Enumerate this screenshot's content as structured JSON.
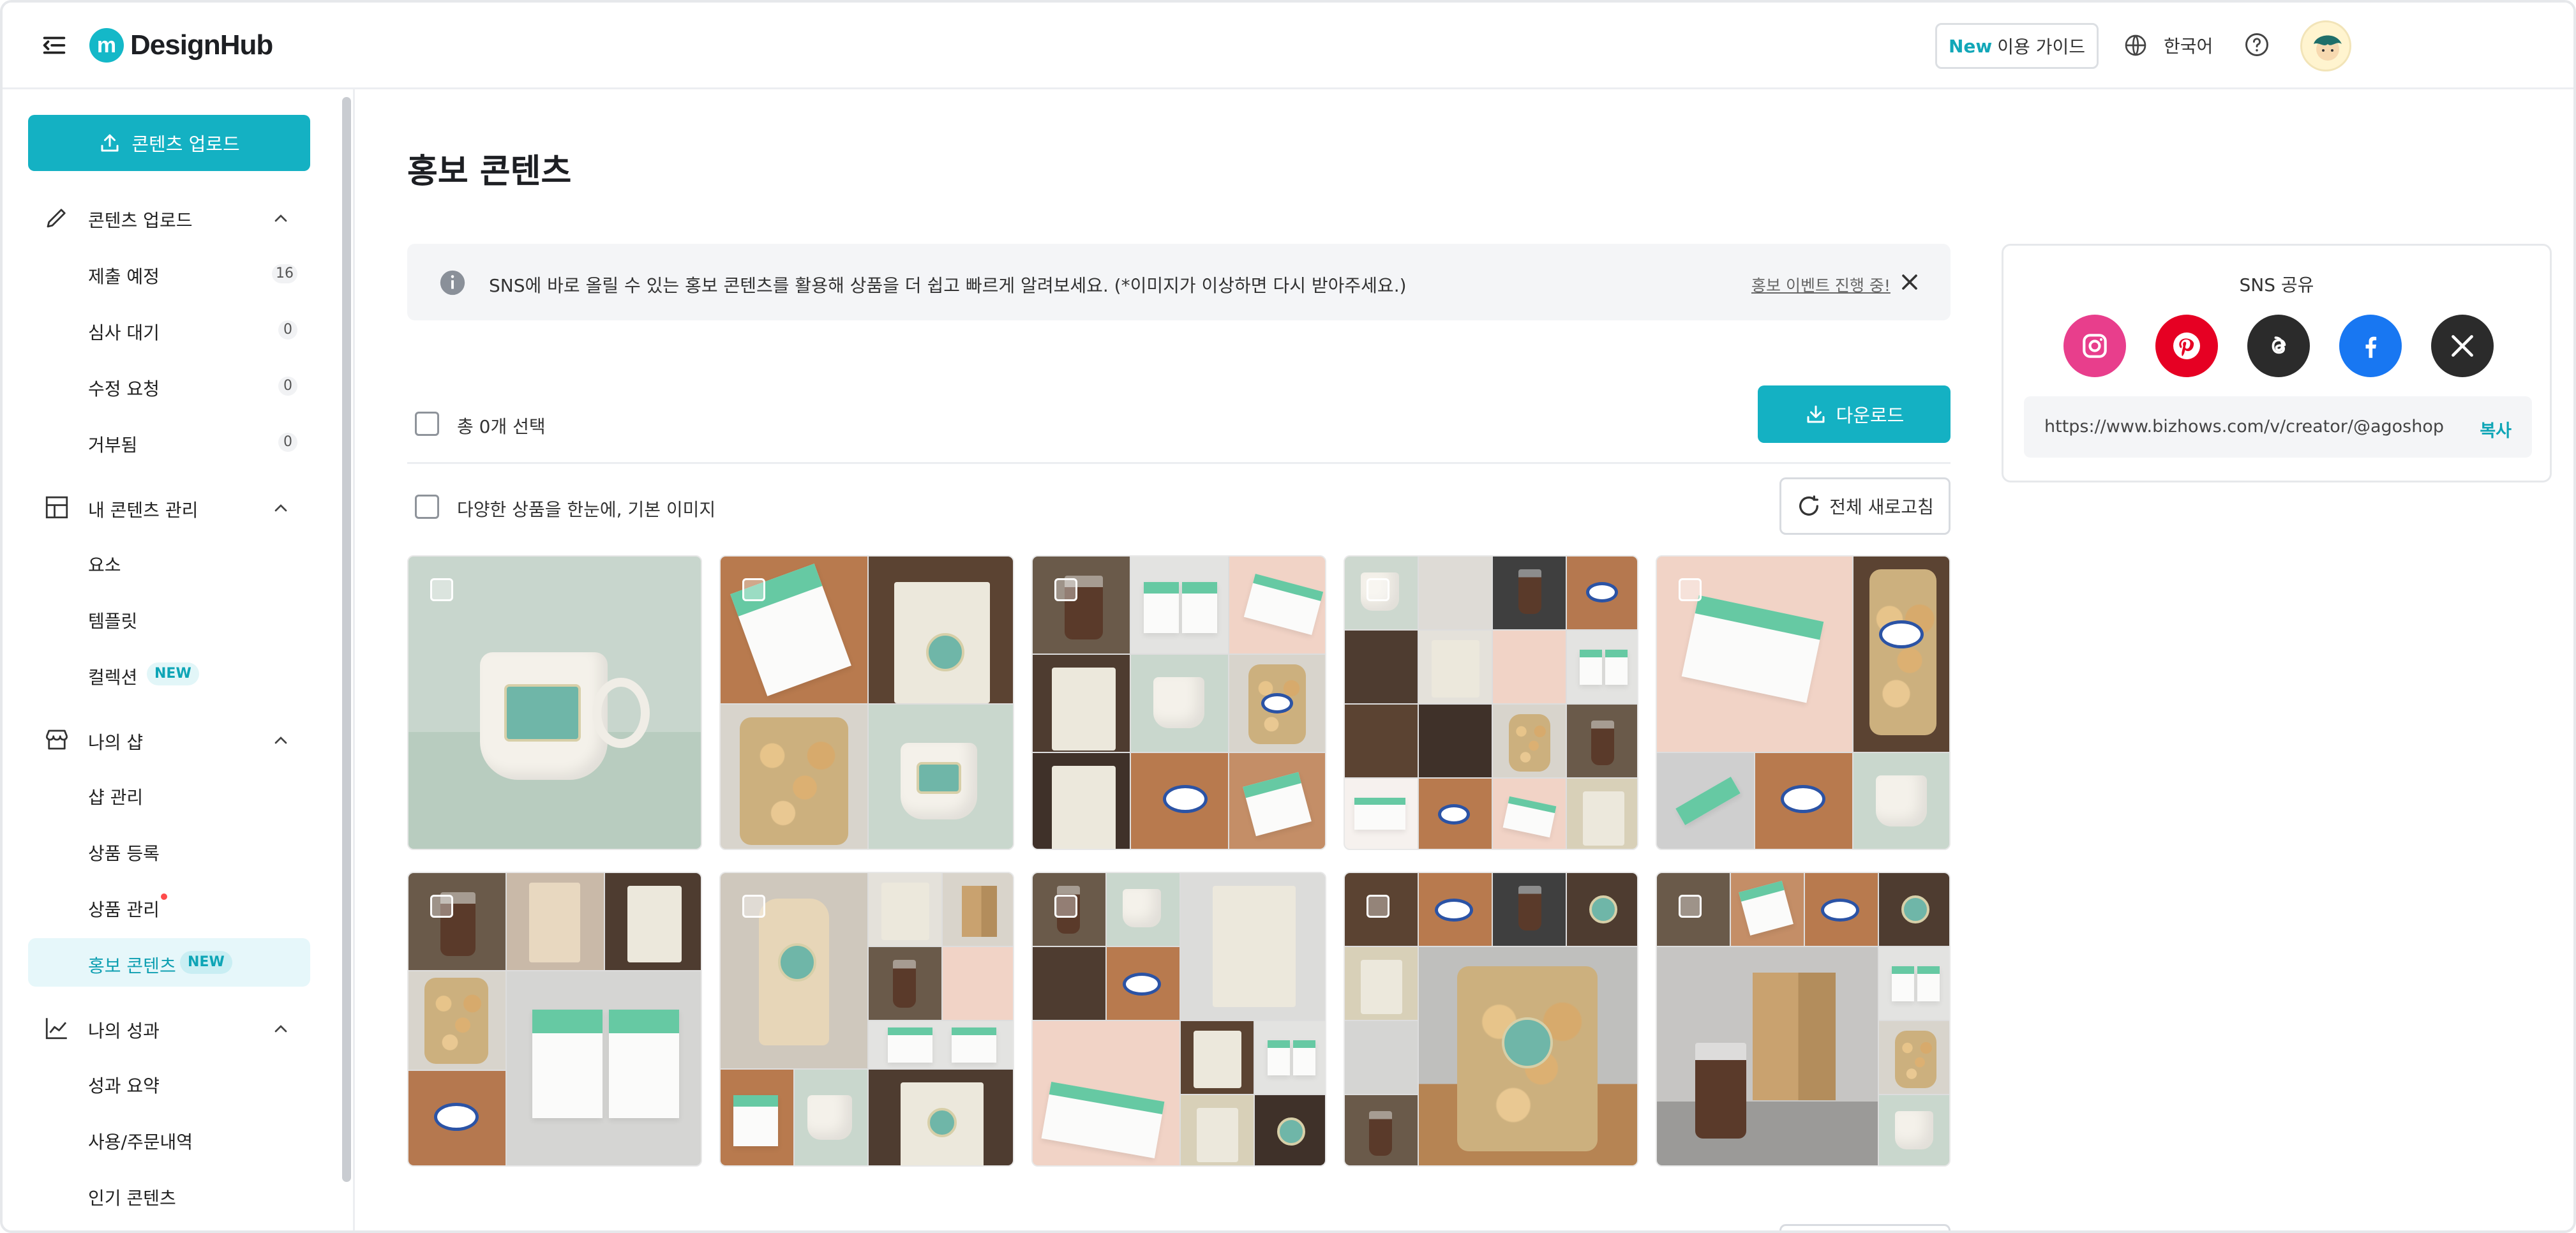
{
  "header": {
    "logo_letter": "m",
    "logo_text": "DesignHub",
    "guide_new": "New",
    "guide_label": "이용 가이드",
    "language": "한국어"
  },
  "sidebar": {
    "upload_button": "콘텐츠 업로드",
    "sections": [
      {
        "label": "콘텐츠 업로드",
        "icon": "pencil-icon",
        "items": [
          {
            "label": "제출 예정",
            "count": "16"
          },
          {
            "label": "심사 대기",
            "count": "0"
          },
          {
            "label": "수정 요청",
            "count": "0"
          },
          {
            "label": "거부됨",
            "count": "0"
          }
        ]
      },
      {
        "label": "내 콘텐츠 관리",
        "icon": "layout-icon",
        "items": [
          {
            "label": "요소"
          },
          {
            "label": "템플릿"
          },
          {
            "label": "컬렉션",
            "badge": "NEW"
          }
        ]
      },
      {
        "label": "나의 샵",
        "icon": "store-icon",
        "items": [
          {
            "label": "샵 관리"
          },
          {
            "label": "상품 등록"
          },
          {
            "label": "상품 관리"
          },
          {
            "label": "홍보 콘텐츠",
            "badge": "NEW"
          }
        ]
      },
      {
        "label": "나의 성과",
        "icon": "chart-line-icon",
        "items": [
          {
            "label": "성과 요약"
          },
          {
            "label": "사용/주문내역"
          },
          {
            "label": "인기 콘텐츠"
          }
        ]
      }
    ]
  },
  "main": {
    "title": "홍보 콘텐츠",
    "notice_text": "SNS에 바로 올릴 수 있는 홍보 콘텐츠를 활용해 상품을 더 쉽고 빠르게 알려보세요. (*이미지가 이상하면 다시 받아주세요.)",
    "notice_link": "홍보 이벤트 진행 중!",
    "select_label": "총 0개 선택",
    "download_button": "다운로드",
    "option_label": "다양한 상품을 한눈에, 기본 이미지",
    "refresh_button": "전체 새로고침"
  },
  "sns": {
    "title": "SNS 공유",
    "networks": [
      {
        "name": "instagram",
        "icon": "instagram-icon",
        "color": "#e83e8c"
      },
      {
        "name": "pinterest",
        "icon": "pinterest-icon",
        "color": "#e60023"
      },
      {
        "name": "threads",
        "icon": "threads-icon",
        "color": "#2b2b2b"
      },
      {
        "name": "facebook",
        "icon": "facebook-icon",
        "color": "#1877f2"
      },
      {
        "name": "x",
        "icon": "x-icon",
        "color": "#2b2b2b"
      }
    ],
    "url": "https://www.bizhows.com/v/creator/@agoshop",
    "copy_label": "복사"
  },
  "colors": {
    "accent": "#14b1c3",
    "active_bg": "#e6f7fa",
    "badge_bg": "#e2f6f8"
  }
}
